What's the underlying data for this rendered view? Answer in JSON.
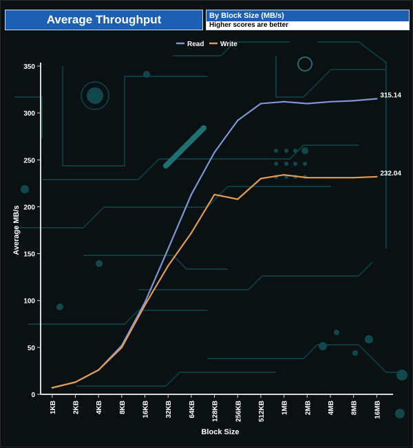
{
  "header": {
    "title": "Average Throughput",
    "subtitle": "By Block Size (MB/s)",
    "note": "Higher scores are better"
  },
  "chart_data": {
    "type": "line",
    "title": "Average Throughput",
    "xlabel": "Block Size",
    "ylabel": "Average MB/s",
    "categories": [
      "1KB",
      "2KB",
      "4KB",
      "8KB",
      "16KB",
      "32KB",
      "64KB",
      "128KB",
      "256KB",
      "512KB",
      "1MB",
      "2MB",
      "4MB",
      "8MB",
      "16MB"
    ],
    "ylim": [
      0,
      350
    ],
    "yticks": [
      0,
      50,
      100,
      150,
      200,
      250,
      300,
      350
    ],
    "legend_position": "top-center",
    "grid": false,
    "series": [
      {
        "name": "Read",
        "color": "#7f97d6",
        "values": [
          7,
          13,
          26,
          52,
          98,
          155,
          213,
          258,
          292,
          310,
          312,
          310,
          312,
          313,
          315.14
        ],
        "end_label": "315.14"
      },
      {
        "name": "Write",
        "color": "#e29c55",
        "values": [
          7,
          13,
          26,
          50,
          95,
          137,
          172,
          213,
          208,
          230,
          234,
          231,
          231,
          231,
          232.04
        ],
        "end_label": "232.04"
      }
    ]
  }
}
